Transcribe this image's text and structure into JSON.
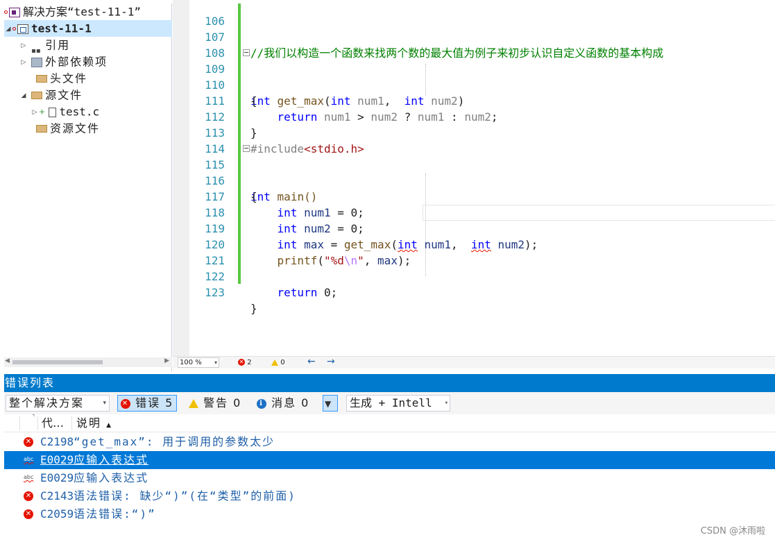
{
  "solution_explorer": {
    "solution_label": "解决方案“test-11-1”",
    "project_label": "test-11-1",
    "items": [
      {
        "label": "引用"
      },
      {
        "label": "外部依赖项"
      },
      {
        "label": "头文件"
      },
      {
        "label": "源文件"
      },
      {
        "label": "test.c"
      },
      {
        "label": "资源文件"
      }
    ]
  },
  "editor": {
    "lines": [
      {
        "num": "106"
      },
      {
        "num": "107",
        "comment": "//我们以构造一个函数来找两个数的最大值为例子来初步认识自定义函数的基本构成"
      },
      {
        "num": "108"
      },
      {
        "num": "109",
        "kw1": "int",
        "fn": "get_max",
        "p1": "(",
        "kw2": "int",
        "a1": "num1",
        "c1": ",",
        "kw3": "int",
        "a2": "num2",
        "p2": ")"
      },
      {
        "num": "110",
        "text": "{"
      },
      {
        "num": "111",
        "kw": "return",
        "expr_a": "num1",
        "op1": ">",
        "expr_b": "num2",
        "op2": "?",
        "expr_c": "num1",
        "op3": ":",
        "expr_d": "num2",
        "semi": ";"
      },
      {
        "num": "112",
        "text": "}"
      },
      {
        "num": "113",
        "directive": "#include",
        "header": "<stdio.h>"
      },
      {
        "num": "114"
      },
      {
        "num": "115",
        "kw": "int",
        "rest": "main()"
      },
      {
        "num": "116",
        "text": "{"
      },
      {
        "num": "117",
        "kw": "int",
        "var": "num1",
        "rest": " = 0;"
      },
      {
        "num": "118",
        "kw": "int",
        "var": "num2",
        "rest": " = 0;"
      },
      {
        "num": "119",
        "kw": "int",
        "var": "max",
        "eq": " = ",
        "fn": "get_max",
        "p1": "(",
        "kw2": "int",
        "a1": "num1",
        "c1": ",",
        "kw3": "int",
        "a2": "num2",
        "p2": ");"
      },
      {
        "num": "120",
        "fn": "printf",
        "p1": "(",
        "s1": "\"%d",
        "esc": "\\n",
        "s2": "\"",
        "c1": ", ",
        "var": "max",
        "p2": ");"
      },
      {
        "num": "121"
      },
      {
        "num": "122",
        "kw": "return",
        "rest": " 0;"
      },
      {
        "num": "123",
        "text": "}"
      }
    ]
  },
  "editor_status": {
    "zoom": "100 %",
    "errors": "2",
    "warnings": "0"
  },
  "error_list": {
    "title": "错误列表",
    "scope": "整个解决方案",
    "errors_btn": "错误 5",
    "warnings_btn": "警告 0",
    "messages_btn": "消息 0",
    "build_filter": "生成 + Intell",
    "col_code": "代…",
    "col_desc": "说明",
    "rows": [
      {
        "code": "C2198",
        "desc": "“get_max”: 用于调用的参数太少",
        "icon": "error"
      },
      {
        "code": "E0029",
        "desc": "应输入表达式",
        "icon": "intellisense"
      },
      {
        "code": "E0029",
        "desc": "应输入表达式",
        "icon": "intellisense"
      },
      {
        "code": "C2143",
        "desc": "语法错误: 缺少“)”(在“类型”的前面)",
        "icon": "error"
      },
      {
        "code": "C2059",
        "desc": "语法错误:“)”",
        "icon": "error"
      }
    ]
  },
  "watermark": "CSDN @沐雨啦",
  "colors": {
    "accent": "#007acc",
    "selected_row": "#0078d7",
    "keyword": "#0000ff",
    "comment": "#008000",
    "line_number": "#2b91af",
    "change_bar": "#57c842",
    "error": "#e51400"
  }
}
